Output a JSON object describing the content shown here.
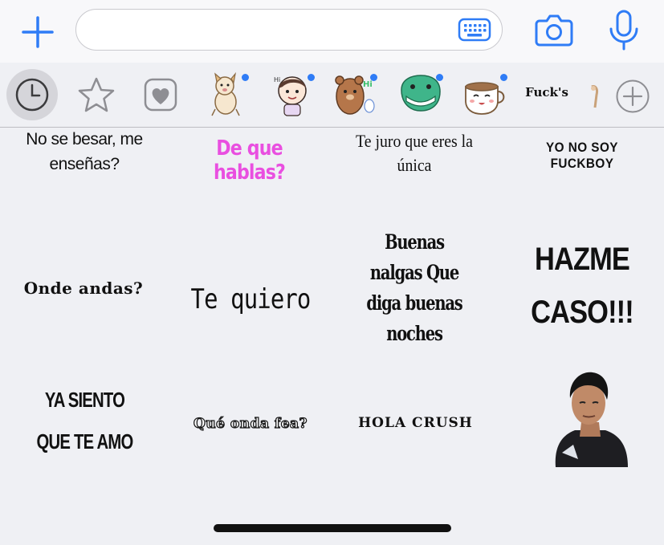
{
  "input_bar": {
    "message_placeholder": "",
    "plus_icon": "plus-icon",
    "keyboard_icon": "keyboard-icon",
    "camera_icon": "camera-icon",
    "microphone_icon": "microphone-icon",
    "accent_color": "#2f7cf6"
  },
  "tray": {
    "items": [
      {
        "name": "recents",
        "icon": "clock-icon",
        "selected": true
      },
      {
        "name": "favorites",
        "icon": "star-icon"
      },
      {
        "name": "heart-pack",
        "icon": "heart-icon"
      },
      {
        "name": "dog-pack",
        "icon": "dog-sticker-icon",
        "new": true
      },
      {
        "name": "girl-pack",
        "icon": "girl-sticker-icon",
        "new": true
      },
      {
        "name": "bear-pack",
        "icon": "bear-sticker-icon",
        "new": true
      },
      {
        "name": "dino-pack",
        "icon": "dino-sticker-icon",
        "new": true
      },
      {
        "name": "cup-pack",
        "icon": "cup-sticker-icon",
        "new": true
      }
    ],
    "text_pack_label": "Fuck's",
    "add_icon": "add-circle-icon"
  },
  "stickers": {
    "s1": "No se besar, me enseñas?",
    "s2": "De que hablas?",
    "s3": "Te juro que eres la única",
    "s4": "YO NO SOY FUCKBOY",
    "s5": "Onde andas?",
    "s6": "Te quiero",
    "s7": "Buenas nalgas Que diga buenas noches",
    "s8": "HAZME CASO!!!",
    "s9": "YA SIENTO QUE TE AMO",
    "s10": "Qué onda fea?",
    "s11": "HOLA CRUSH",
    "s12": "photo-sticker"
  }
}
